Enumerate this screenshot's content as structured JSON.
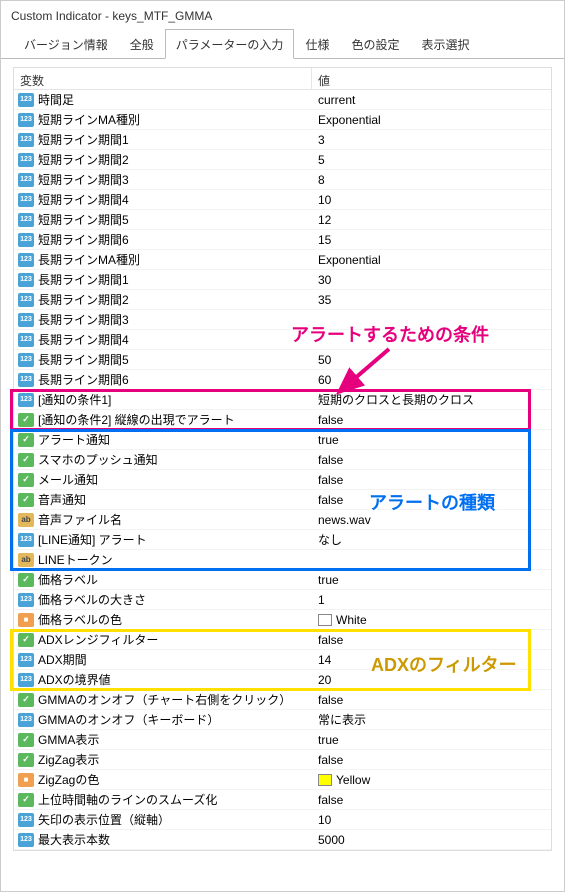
{
  "window": {
    "title": "Custom Indicator - keys_MTF_GMMA"
  },
  "tabs": [
    {
      "label": "バージョン情報"
    },
    {
      "label": "全般"
    },
    {
      "label": "パラメーターの入力",
      "active": true
    },
    {
      "label": "仕様"
    },
    {
      "label": "色の設定"
    },
    {
      "label": "表示選択"
    }
  ],
  "headers": {
    "var": "変数",
    "val": "値"
  },
  "rows": [
    {
      "icon": "int",
      "var": "時間足",
      "val": "current"
    },
    {
      "icon": "int",
      "var": "短期ラインMA種別",
      "val": "Exponential"
    },
    {
      "icon": "int",
      "var": "短期ライン期間1",
      "val": "3"
    },
    {
      "icon": "int",
      "var": "短期ライン期間2",
      "val": "5"
    },
    {
      "icon": "int",
      "var": "短期ライン期間3",
      "val": "8"
    },
    {
      "icon": "int",
      "var": "短期ライン期間4",
      "val": "10"
    },
    {
      "icon": "int",
      "var": "短期ライン期間5",
      "val": "12"
    },
    {
      "icon": "int",
      "var": "短期ライン期間6",
      "val": "15"
    },
    {
      "icon": "int",
      "var": "長期ラインMA種別",
      "val": "Exponential"
    },
    {
      "icon": "int",
      "var": "長期ライン期間1",
      "val": "30"
    },
    {
      "icon": "int",
      "var": "長期ライン期間2",
      "val": "35"
    },
    {
      "icon": "int",
      "var": "長期ライン期間3",
      "val": ""
    },
    {
      "icon": "int",
      "var": "長期ライン期間4",
      "val": ""
    },
    {
      "icon": "int",
      "var": "長期ライン期間5",
      "val": "50"
    },
    {
      "icon": "int",
      "var": "長期ライン期間6",
      "val": "60"
    },
    {
      "icon": "int",
      "var": "[通知の条件1]",
      "val": "短期のクロスと長期のクロス"
    },
    {
      "icon": "bool",
      "var": "[通知の条件2] 縦線の出現でアラート",
      "val": "false"
    },
    {
      "icon": "bool",
      "var": "アラート通知",
      "val": "true"
    },
    {
      "icon": "bool",
      "var": "スマホのプッシュ通知",
      "val": "false"
    },
    {
      "icon": "bool",
      "var": "メール通知",
      "val": "false"
    },
    {
      "icon": "bool",
      "var": "音声通知",
      "val": "false"
    },
    {
      "icon": "str",
      "var": "音声ファイル名",
      "val": "news.wav"
    },
    {
      "icon": "int",
      "var": "[LINE通知] アラート",
      "val": "なし"
    },
    {
      "icon": "str",
      "var": "LINEトークン",
      "val": ""
    },
    {
      "icon": "bool",
      "var": "価格ラベル",
      "val": "true"
    },
    {
      "icon": "int",
      "var": "価格ラベルの大きさ",
      "val": "1"
    },
    {
      "icon": "color",
      "var": "価格ラベルの色",
      "val": "White",
      "swatch": "#ffffff"
    },
    {
      "icon": "bool",
      "var": "ADXレンジフィルター",
      "val": "false"
    },
    {
      "icon": "int",
      "var": "ADX期間",
      "val": "14"
    },
    {
      "icon": "int",
      "var": "ADXの境界値",
      "val": "20"
    },
    {
      "icon": "bool",
      "var": "GMMAのオンオフ（チャート右側をクリック）",
      "val": "false"
    },
    {
      "icon": "int",
      "var": "GMMAのオンオフ（キーボード）",
      "val": "常に表示"
    },
    {
      "icon": "bool",
      "var": "GMMA表示",
      "val": "true"
    },
    {
      "icon": "bool",
      "var": "ZigZag表示",
      "val": "false"
    },
    {
      "icon": "color",
      "var": "ZigZagの色",
      "val": "Yellow",
      "swatch": "#ffff00"
    },
    {
      "icon": "bool",
      "var": "上位時間軸のラインのスムーズ化",
      "val": "false"
    },
    {
      "icon": "int",
      "var": "矢印の表示位置（縦軸）",
      "val": "10"
    },
    {
      "icon": "int",
      "var": "最大表示本数",
      "val": "5000"
    }
  ],
  "annotations": {
    "red": "アラートするための条件",
    "blue": "アラートの種類",
    "yellow": "ADXのフィルター"
  }
}
